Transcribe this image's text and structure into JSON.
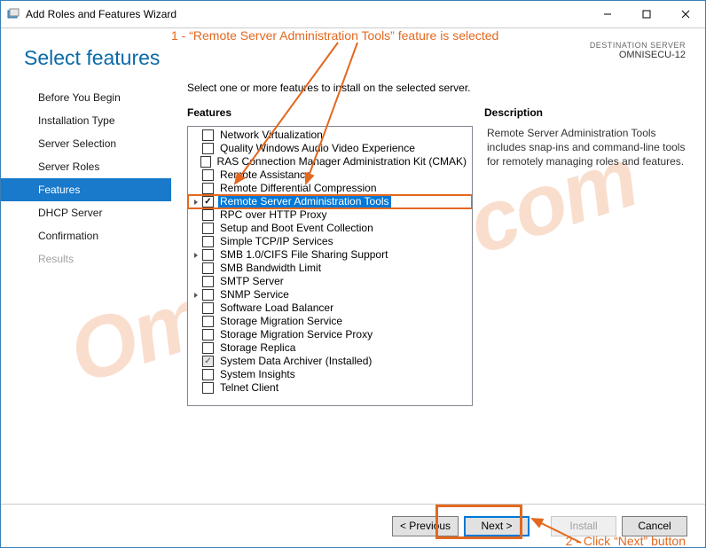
{
  "window": {
    "title": "Add Roles and Features Wizard"
  },
  "page_title": "Select features",
  "watermark": "Omnisecu.com",
  "destination": {
    "label": "DESTINATION SERVER",
    "value": "OMNISECU-12"
  },
  "nav": [
    {
      "label": "Before You Begin",
      "selected": false,
      "muted": false
    },
    {
      "label": "Installation Type",
      "selected": false,
      "muted": false
    },
    {
      "label": "Server Selection",
      "selected": false,
      "muted": false
    },
    {
      "label": "Server Roles",
      "selected": false,
      "muted": false
    },
    {
      "label": "Features",
      "selected": true,
      "muted": false
    },
    {
      "label": "DHCP Server",
      "selected": false,
      "muted": false
    },
    {
      "label": "Confirmation",
      "selected": false,
      "muted": false
    },
    {
      "label": "Results",
      "selected": false,
      "muted": true
    }
  ],
  "main": {
    "instruction": "Select one or more features to install on the selected server.",
    "features_heading": "Features",
    "desc_heading": "Description",
    "description": "Remote Server Administration Tools includes snap-ins and command-line tools for remotely managing roles and features."
  },
  "features": [
    {
      "label": "Network Virtualization",
      "checked": false,
      "exp": false,
      "sel": false
    },
    {
      "label": "Quality Windows Audio Video Experience",
      "checked": false,
      "exp": false,
      "sel": false
    },
    {
      "label": "RAS Connection Manager Administration Kit (CMAK)",
      "checked": false,
      "exp": false,
      "sel": false
    },
    {
      "label": "Remote Assistance",
      "checked": false,
      "exp": false,
      "sel": false
    },
    {
      "label": "Remote Differential Compression",
      "checked": false,
      "exp": false,
      "sel": false
    },
    {
      "label": "Remote Server Administration Tools",
      "checked": true,
      "exp": true,
      "sel": true
    },
    {
      "label": "RPC over HTTP Proxy",
      "checked": false,
      "exp": false,
      "sel": false
    },
    {
      "label": "Setup and Boot Event Collection",
      "checked": false,
      "exp": false,
      "sel": false
    },
    {
      "label": "Simple TCP/IP Services",
      "checked": false,
      "exp": false,
      "sel": false
    },
    {
      "label": "SMB 1.0/CIFS File Sharing Support",
      "checked": false,
      "exp": true,
      "sel": false
    },
    {
      "label": "SMB Bandwidth Limit",
      "checked": false,
      "exp": false,
      "sel": false
    },
    {
      "label": "SMTP Server",
      "checked": false,
      "exp": false,
      "sel": false
    },
    {
      "label": "SNMP Service",
      "checked": false,
      "exp": true,
      "sel": false
    },
    {
      "label": "Software Load Balancer",
      "checked": false,
      "exp": false,
      "sel": false
    },
    {
      "label": "Storage Migration Service",
      "checked": false,
      "exp": false,
      "sel": false
    },
    {
      "label": "Storage Migration Service Proxy",
      "checked": false,
      "exp": false,
      "sel": false
    },
    {
      "label": "Storage Replica",
      "checked": false,
      "exp": false,
      "sel": false
    },
    {
      "label": "System Data Archiver (Installed)",
      "checked": "grey",
      "exp": false,
      "sel": false
    },
    {
      "label": "System Insights",
      "checked": false,
      "exp": false,
      "sel": false
    },
    {
      "label": "Telnet Client",
      "checked": false,
      "exp": false,
      "sel": false
    }
  ],
  "buttons": {
    "prev": "< Previous",
    "next": "Next >",
    "install": "Install",
    "cancel": "Cancel"
  },
  "annotations": {
    "a1": "1 -  “Remote Server Administration Tools” feature is selected",
    "a2": "2 -  Click “Next” button"
  }
}
